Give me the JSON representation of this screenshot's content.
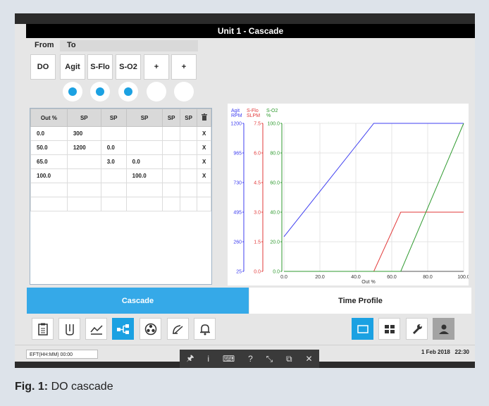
{
  "window": {
    "title": "Unit 1 - Cascade"
  },
  "headers": {
    "from": "From",
    "to": "To"
  },
  "from_tile": "DO",
  "to_tiles": [
    "Agit",
    "S-Flo",
    "S-O2",
    "+",
    "+"
  ],
  "radio_states": [
    true,
    true,
    true,
    false,
    false
  ],
  "table": {
    "columns": [
      "Out %",
      "SP",
      "SP",
      "SP",
      "SP",
      "SP"
    ],
    "rows": [
      [
        "0.0",
        "300",
        "",
        "",
        "",
        "",
        "X"
      ],
      [
        "50.0",
        "1200",
        "0.0",
        "",
        "",
        "",
        "X"
      ],
      [
        "65.0",
        "",
        "3.0",
        "0.0",
        "",
        "",
        "X"
      ],
      [
        "100.0",
        "",
        "",
        "100.0",
        "",
        "",
        "X"
      ],
      [
        "",
        "",
        "",
        "",
        "",
        "",
        ""
      ],
      [
        "",
        "",
        "",
        "",
        "",
        "",
        ""
      ]
    ]
  },
  "chart_data": {
    "type": "line",
    "xlabel": "Out %",
    "xlim": [
      0,
      100
    ],
    "x_ticks": [
      "0.0",
      "20.0",
      "40.0",
      "60.0",
      "80.0",
      "100.0"
    ],
    "axes": [
      {
        "name": "Agit",
        "unit": "RPM",
        "color": "#3f3ff0",
        "ticks": [
          "1200",
          "965",
          "730",
          "495",
          "260",
          "25"
        ],
        "range": [
          25,
          1200
        ]
      },
      {
        "name": "S-Flo",
        "unit": "SLPM",
        "color": "#e23a3a",
        "ticks": [
          "7.5",
          "6.0",
          "4.5",
          "3.0",
          "1.5",
          "0.0"
        ],
        "range": [
          0,
          7.5
        ]
      },
      {
        "name": "S-O2",
        "unit": "%",
        "color": "#2f9a2f",
        "ticks": [
          "100.0",
          "80.0",
          "60.0",
          "40.0",
          "20.0",
          "0.0"
        ],
        "range": [
          0,
          100
        ]
      }
    ],
    "series": [
      {
        "name": "Agit",
        "color": "#3f3ff0",
        "axis": 0,
        "x": [
          0,
          50,
          100
        ],
        "y": [
          300,
          1200,
          1200
        ]
      },
      {
        "name": "S-Flo",
        "color": "#e23a3a",
        "axis": 1,
        "x": [
          0,
          50,
          65,
          100
        ],
        "y": [
          0,
          0,
          3.0,
          3.0
        ]
      },
      {
        "name": "S-O2",
        "color": "#2f9a2f",
        "axis": 2,
        "x": [
          0,
          65,
          100
        ],
        "y": [
          0,
          0,
          100
        ]
      }
    ]
  },
  "tabs": {
    "cascade": "Cascade",
    "time_profile": "Time Profile"
  },
  "status": {
    "eft": "EFT(HH:MM) 00:00",
    "date": "1 Feb 2018",
    "time": "22:30"
  },
  "caption": {
    "label": "Fig. 1:",
    "text": "DO cascade"
  }
}
